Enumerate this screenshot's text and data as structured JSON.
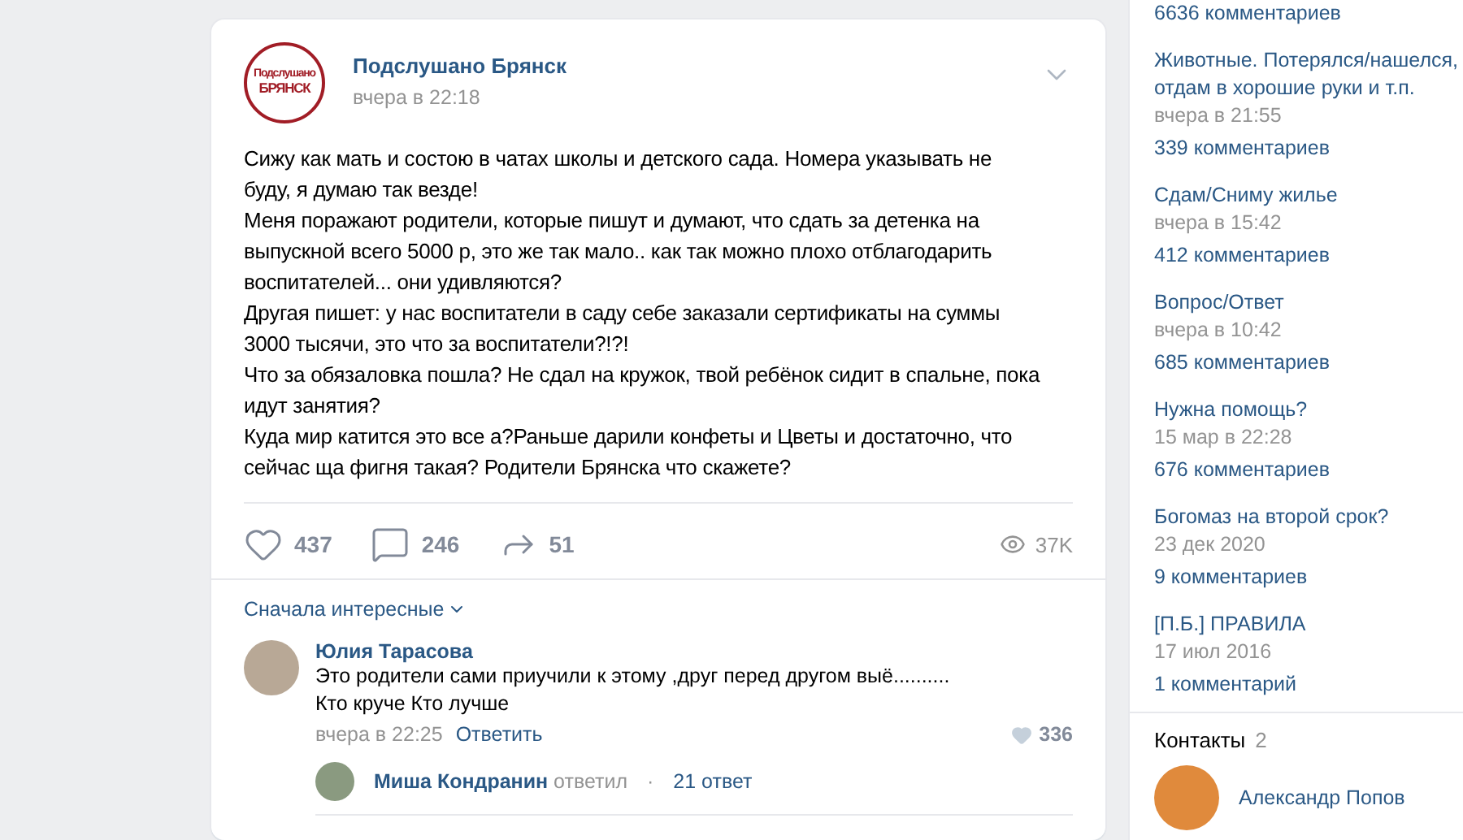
{
  "post": {
    "author": "Подслушано Брянск",
    "logo": [
      "Подслушано",
      "БРЯНСК"
    ],
    "time": "вчера в 22:18",
    "paragraphs": [
      "Сижу как мать и состою в чатах школы и детского сада. Номера указывать не буду, я думаю так везде!",
      "Меня поражают родители, которые пишут и думают, что сдать за детенка на выпускной всего 5000 р, это же так мало.. как так можно плохо отблагодарить воспитателей... они удивляются?",
      "Другая пишет: у нас воспитатели в саду себе заказали сертификаты на суммы 3000 тысячи, это что за воспитатели?!?!",
      "Что за обязаловка пошла? Не сдал на кружок, твой ребёнок сидит в спальне, пока идут занятия?",
      "Куда мир катится это все а?Раньше дарили конфеты и Цветы и достаточно, что сейчас ща фигня такая? Родители Брянска что скажете?"
    ],
    "likes": "437",
    "comments": "246",
    "shares": "51",
    "views": "37K"
  },
  "comments": {
    "sort": "Сначала интересные",
    "items": [
      {
        "author": "Юлия Тарасова",
        "lines": [
          "Это родители сами приучили к этому ,друг перед другом выё..........",
          "Кто круче Кто лучше"
        ],
        "time": "вчера в 22:25",
        "reply": "Ответить",
        "likes": "336",
        "thread": {
          "author": "Миша Кондранин",
          "action": "ответил",
          "separator": "·",
          "count": "21 ответ"
        }
      }
    ]
  },
  "sidebar": {
    "top_count": "6636 комментариев",
    "topics": [
      {
        "title": "Животные. Потерялся/нашелся, отдам в хорошие руки и т.п.",
        "date": "вчера в 21:55",
        "count": "339 комментариев"
      },
      {
        "title": "Сдам/Сниму жилье",
        "date": "вчера в 15:42",
        "count": "412 комментариев"
      },
      {
        "title": "Вопрос/Ответ",
        "date": "вчера в 10:42",
        "count": "685 комментариев"
      },
      {
        "title": "Нужна помощь?",
        "date": "15 мар в 22:28",
        "count": "676 комментариев"
      },
      {
        "title": "Богомаз на второй срок?",
        "date": "23 дек 2020",
        "count": "9 комментариев"
      },
      {
        "title": "[П.Б.] ПРАВИЛА",
        "date": "17 июл 2016",
        "count": "1 комментарий"
      }
    ],
    "contacts": {
      "title": "Контакты",
      "count": "2",
      "items": [
        {
          "name": "Александр Попов"
        }
      ]
    }
  }
}
